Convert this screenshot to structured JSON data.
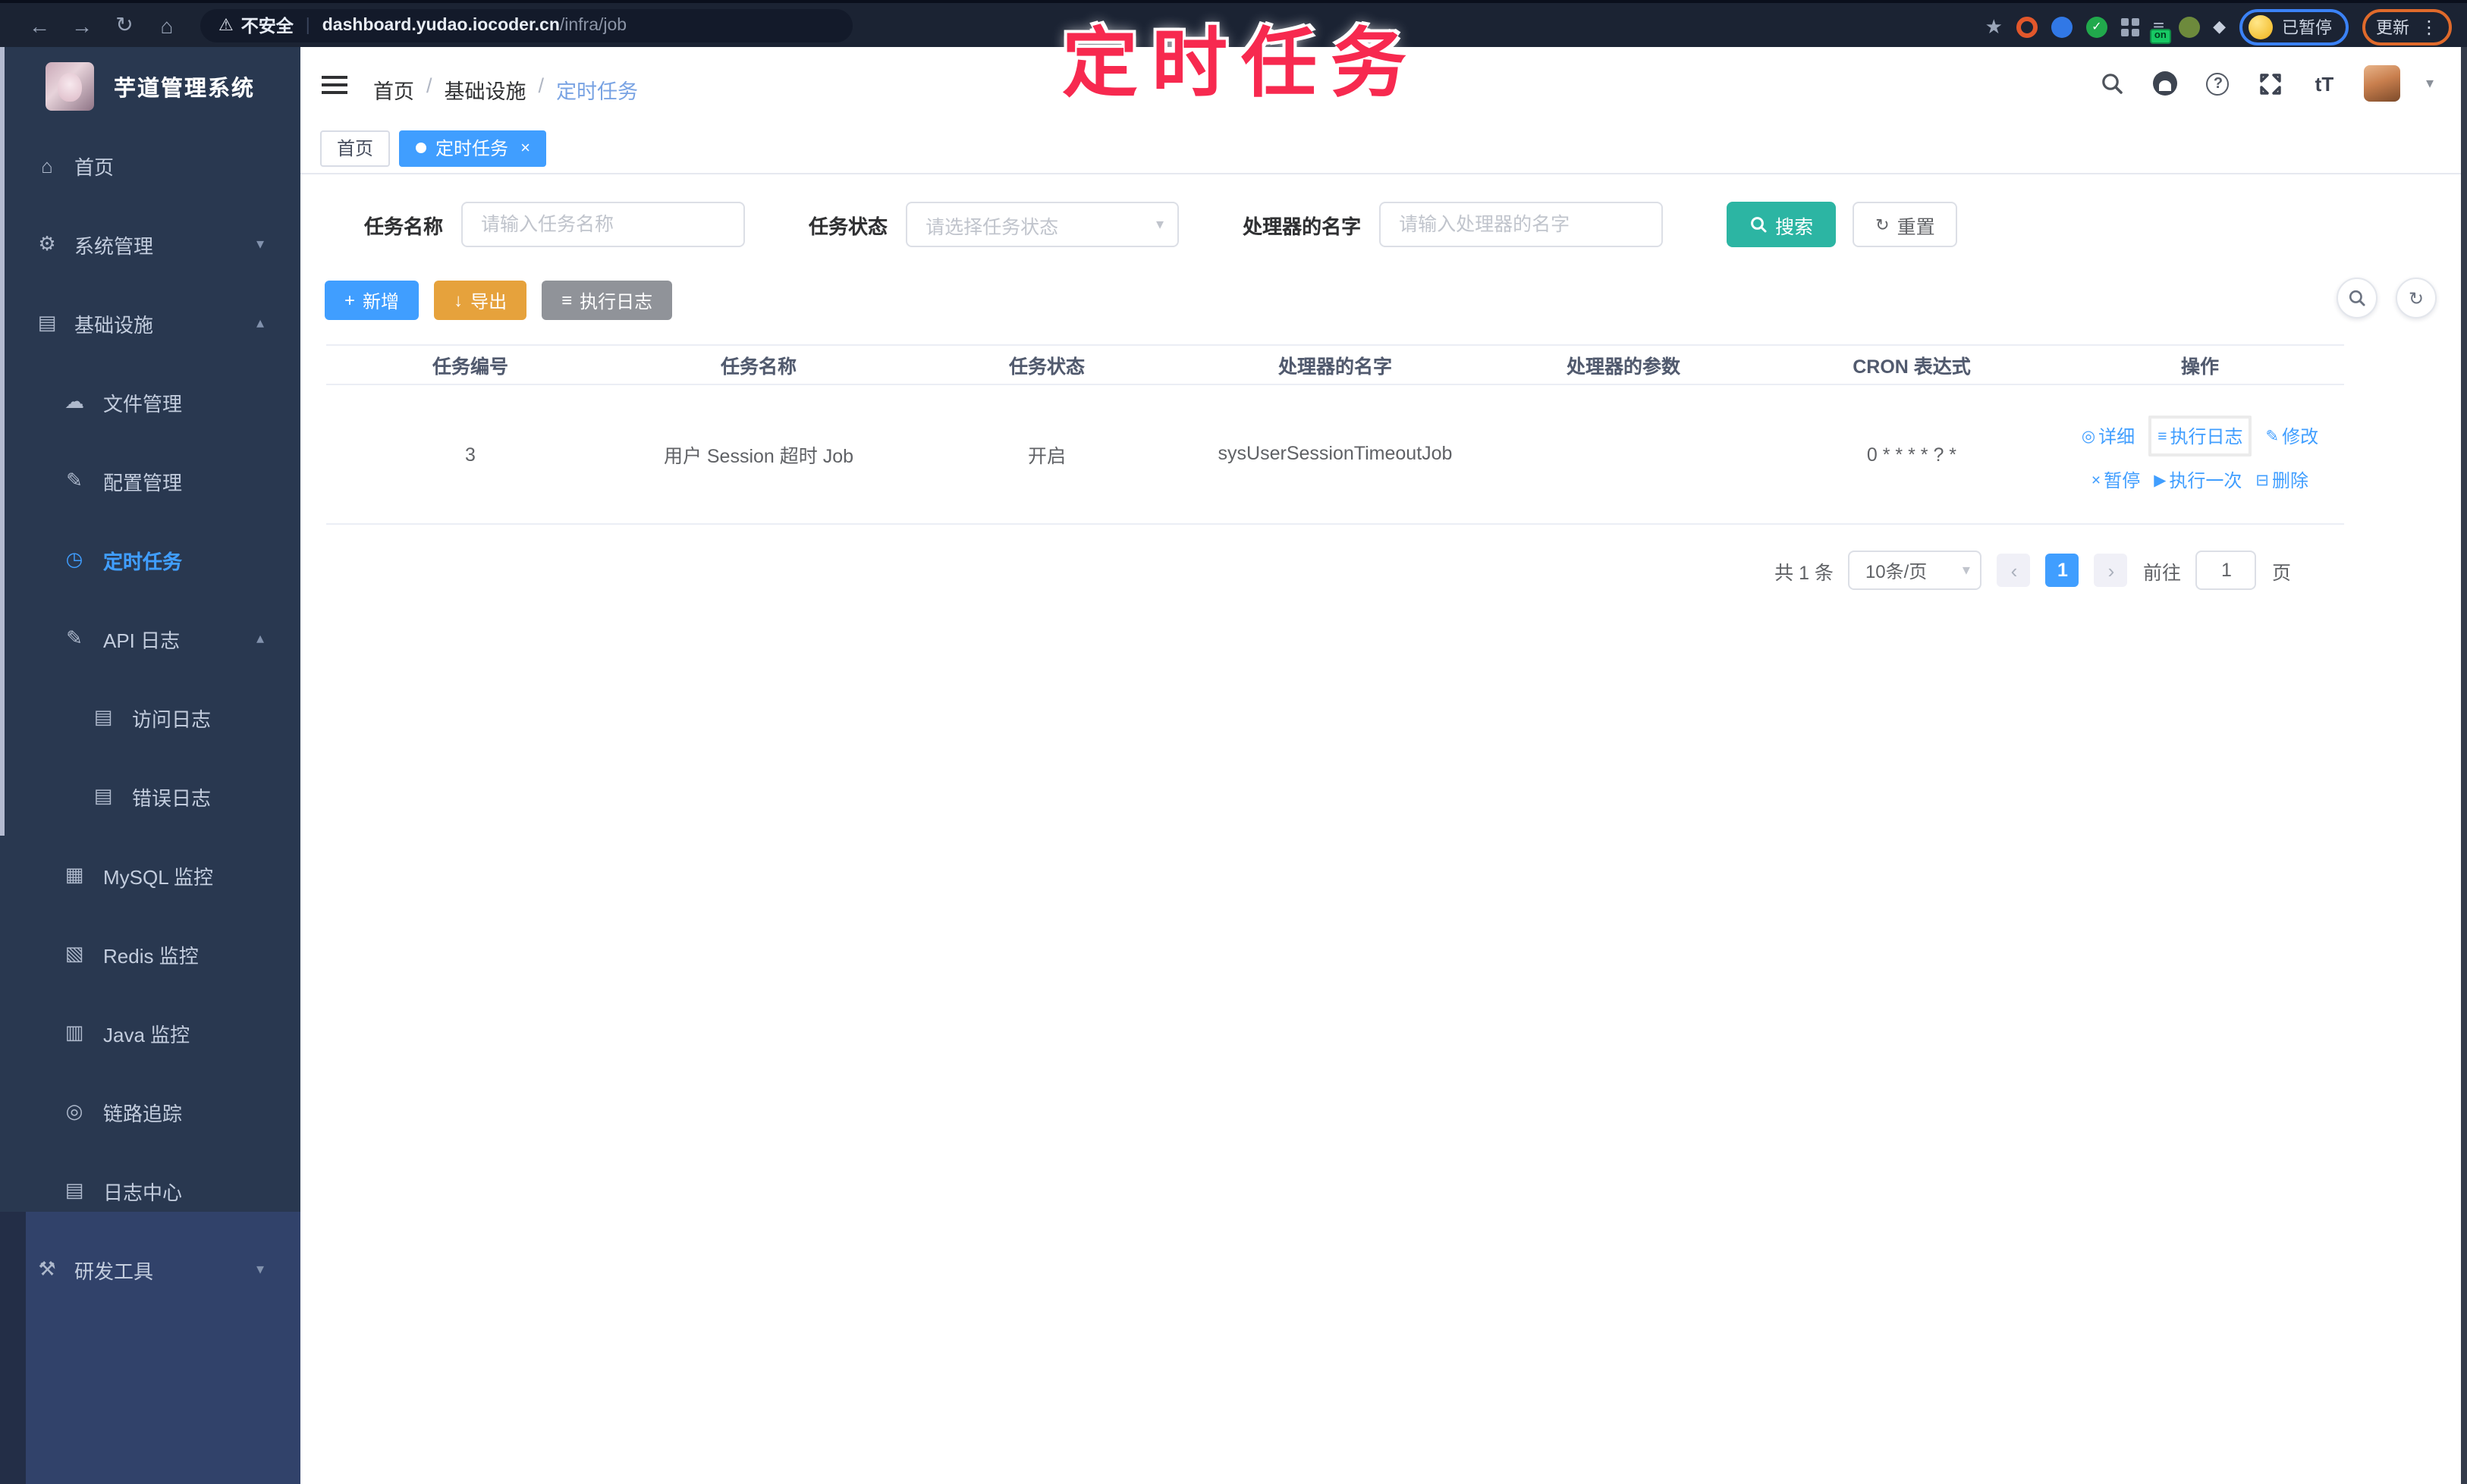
{
  "overlay": {
    "title": "定时任务"
  },
  "browser": {
    "security_label": "不安全",
    "url_host": "dashboard.yudao.iocoder.cn",
    "url_path": "/infra/job",
    "extension_badge": "on",
    "paused_label": "已暂停",
    "update_label": "更新"
  },
  "sidebar": {
    "logo_title": "芋道管理系统",
    "items": [
      {
        "label": "首页"
      },
      {
        "label": "系统管理"
      },
      {
        "label": "基础设施"
      },
      {
        "label": "文件管理"
      },
      {
        "label": "配置管理"
      },
      {
        "label": "定时任务"
      },
      {
        "label": "API 日志"
      },
      {
        "label": "访问日志"
      },
      {
        "label": "错误日志"
      },
      {
        "label": "MySQL 监控"
      },
      {
        "label": "Redis 监控"
      },
      {
        "label": "Java 监控"
      },
      {
        "label": "链路追踪"
      },
      {
        "label": "日志中心"
      },
      {
        "label": "研发工具"
      }
    ]
  },
  "header": {
    "breadcrumb": [
      "首页",
      "基础设施",
      "定时任务"
    ],
    "separator": "/"
  },
  "tags": {
    "home": "首页",
    "current": "定时任务"
  },
  "filter": {
    "name_label": "任务名称",
    "name_placeholder": "请输入任务名称",
    "status_label": "任务状态",
    "status_placeholder": "请选择任务状态",
    "handler_label": "处理器的名字",
    "handler_placeholder": "请输入处理器的名字",
    "search_label": "搜索",
    "reset_label": "重置"
  },
  "toolbar": {
    "add_label": "新增",
    "export_label": "导出",
    "job_log_label": "执行日志"
  },
  "table": {
    "columns": [
      "任务编号",
      "任务名称",
      "任务状态",
      "处理器的名字",
      "处理器的参数",
      "CRON 表达式",
      "操作"
    ],
    "row": {
      "id": "3",
      "name": "用户 Session 超时 Job",
      "status": "开启",
      "handler": "sysUserSessionTimeoutJob",
      "param": "",
      "cron": "0 * * * * ? *",
      "actions": [
        "详细",
        "执行日志",
        "修改",
        "暂停",
        "执行一次",
        "删除"
      ]
    }
  },
  "pagination": {
    "total": "共 1 条",
    "page_size": "10条/页",
    "current_page": "1",
    "goto_label": "前往",
    "goto_value": "1",
    "unit_label": "页"
  },
  "icons": {
    "back": "←",
    "forward": "→",
    "reload": "↻",
    "home": "⌂",
    "warning": "⚠",
    "divider": "|",
    "star": "★",
    "check": "✓",
    "stack": "≡",
    "pin": "◆",
    "dots": "⋮",
    "help": "?",
    "font_size": "tT",
    "caret_down": "▾",
    "chevron_down": "▾",
    "chevron_up": "▴",
    "dot": "●",
    "close": "×",
    "plus": "+",
    "refresh": "↻",
    "export_arrow": "↓",
    "list": "≡",
    "menu_home": "⌂",
    "menu_gear": "⚙",
    "menu_infra": "▤",
    "menu_cloud": "☁",
    "menu_edit": "✎",
    "menu_timer": "◷",
    "menu_api": "✎",
    "menu_doc": "▤",
    "menu_db": "▦",
    "menu_redis": "▧",
    "menu_java": "▥",
    "menu_eye": "◎",
    "menu_log": "▤",
    "menu_tools": "⚒",
    "action_detail": "◎",
    "action_log": "≡",
    "action_edit": "✎",
    "action_pause": "×",
    "action_run": "▶",
    "action_delete": "⊟",
    "prev": "‹",
    "next": "›"
  },
  "colors": {
    "primary": "#409eff",
    "search_teal": "#2cb5a3",
    "warning": "#e6a23c",
    "info": "#909399",
    "sidebar_bg": "#293850",
    "sidebar_bottom_bg": "#31426a",
    "chrome_bg": "#1b2333",
    "overlay_pink": "#f7294f",
    "annotation_blue": "#3b82f6",
    "annotation_orange": "#e06a2b"
  }
}
